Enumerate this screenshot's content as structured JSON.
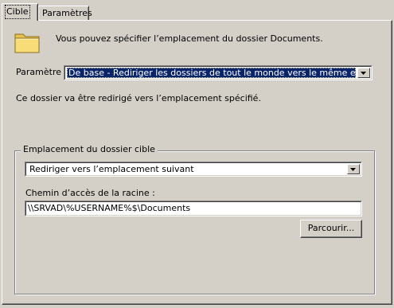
{
  "tabs": [
    {
      "label": "Cible",
      "active": true
    },
    {
      "label": "Paramètres",
      "active": false
    }
  ],
  "intro": {
    "icon": "folder-icon",
    "text": "Vous pouvez spécifier l’emplacement du dossier Documents."
  },
  "setting": {
    "label": "Paramètre :",
    "selected": "De base - Rediriger les dossiers de tout le monde vers le même emplacement"
  },
  "description": "Ce dossier va être redirigé vers l’emplacement spécifié.",
  "target_group": {
    "legend": "Emplacement du dossier cible",
    "location_option": "Rediriger vers l’emplacement suivant",
    "root_path_label": "Chemin d’accès de la racine :",
    "root_path_value": "\\\\SRVAD\\%USERNAME%$\\Documents",
    "browse_button": "Parcourir..."
  },
  "colors": {
    "window_bg": "#d4d0c8",
    "selection_bg": "#0a246a",
    "folder_yellow": "#f5d66a"
  }
}
